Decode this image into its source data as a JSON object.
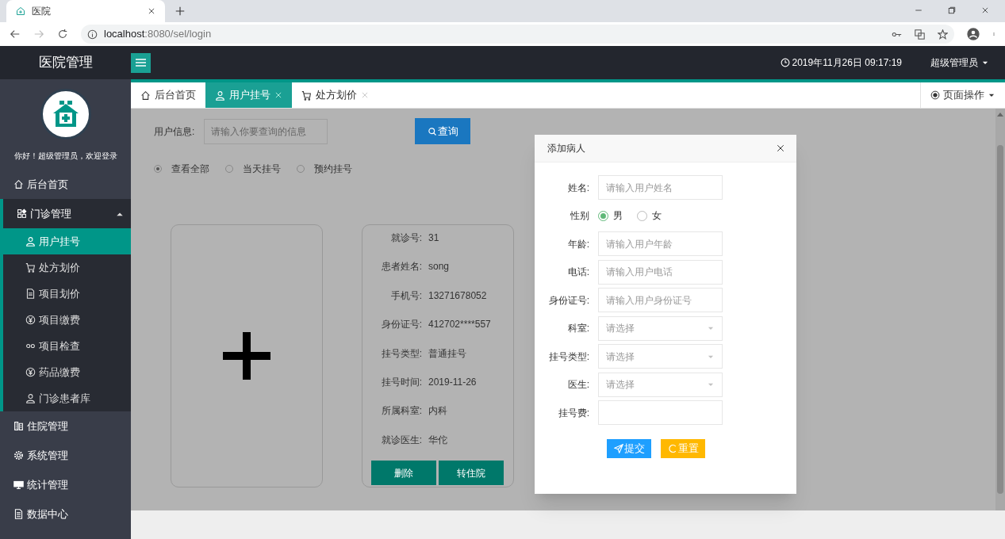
{
  "browser": {
    "tab_title": "医院",
    "url_host": "localhost",
    "url_path": ":8080/sel/login"
  },
  "header": {
    "brand": "医院管理",
    "datetime": "2019年11月26日 09:17:19",
    "user": "超级管理员"
  },
  "sidebar": {
    "welcome": "你好！超级管理员，欢迎登录",
    "items": [
      {
        "label": "后台首页",
        "expanded": false
      },
      {
        "label": "门诊管理",
        "expanded": true,
        "children": [
          {
            "label": "用户挂号",
            "selected": true
          },
          {
            "label": "处方划价",
            "selected": false
          },
          {
            "label": "项目划价",
            "selected": false
          },
          {
            "label": "项目缴费",
            "selected": false
          },
          {
            "label": "项目检查",
            "selected": false
          },
          {
            "label": "药品缴费",
            "selected": false
          },
          {
            "label": "门诊患者库",
            "selected": false
          }
        ]
      },
      {
        "label": "住院管理",
        "expanded": false
      },
      {
        "label": "系统管理",
        "expanded": false
      },
      {
        "label": "统计管理",
        "expanded": false
      },
      {
        "label": "数据中心",
        "expanded": false
      }
    ]
  },
  "tabs": [
    {
      "label": "后台首页",
      "selected": false,
      "closable": false
    },
    {
      "label": "用户挂号",
      "selected": true,
      "closable": true
    },
    {
      "label": "处方划价",
      "selected": false,
      "closable": true
    }
  ],
  "page_ops": "页面操作",
  "search": {
    "label": "用户信息:",
    "placeholder": "请输入你要查询的信息",
    "button": "查询"
  },
  "filters": [
    {
      "label": "查看全部",
      "selected": true
    },
    {
      "label": "当天挂号",
      "selected": false
    },
    {
      "label": "预约挂号",
      "selected": false
    }
  ],
  "patient_card": {
    "fields": [
      {
        "label": "就诊号:",
        "value": "31"
      },
      {
        "label": "患者姓名:",
        "value": "song"
      },
      {
        "label": "手机号:",
        "value": "13271678052"
      },
      {
        "label": "身份证号:",
        "value": "412702****557"
      },
      {
        "label": "挂号类型:",
        "value": "普通挂号"
      },
      {
        "label": "挂号时间:",
        "value": "2019-11-26"
      },
      {
        "label": "所属科室:",
        "value": "内科"
      },
      {
        "label": "就诊医生:",
        "value": "华佗"
      }
    ],
    "buttons": [
      "删除",
      "转住院"
    ]
  },
  "modal": {
    "title": "添加病人",
    "fields": [
      {
        "kind": "text",
        "label": "姓名:",
        "placeholder": "请输入用户姓名"
      },
      {
        "kind": "radio",
        "label": "性别",
        "options": [
          {
            "label": "男",
            "selected": true
          },
          {
            "label": "女",
            "selected": false
          }
        ]
      },
      {
        "kind": "text",
        "label": "年龄:",
        "placeholder": "请输入用户年龄"
      },
      {
        "kind": "text",
        "label": "电话:",
        "placeholder": "请输入用户电话"
      },
      {
        "kind": "text",
        "label": "身份证号:",
        "placeholder": "请输入用户身份证号"
      },
      {
        "kind": "select",
        "label": "科室:",
        "placeholder": "请选择"
      },
      {
        "kind": "select",
        "label": "挂号类型:",
        "placeholder": "请选择"
      },
      {
        "kind": "select",
        "label": "医生:",
        "placeholder": "请选择"
      },
      {
        "kind": "text",
        "label": "挂号费:"
      }
    ],
    "buttons": [
      {
        "kind": "submit",
        "label": "提交"
      },
      {
        "kind": "reset",
        "label": "重置"
      }
    ]
  }
}
